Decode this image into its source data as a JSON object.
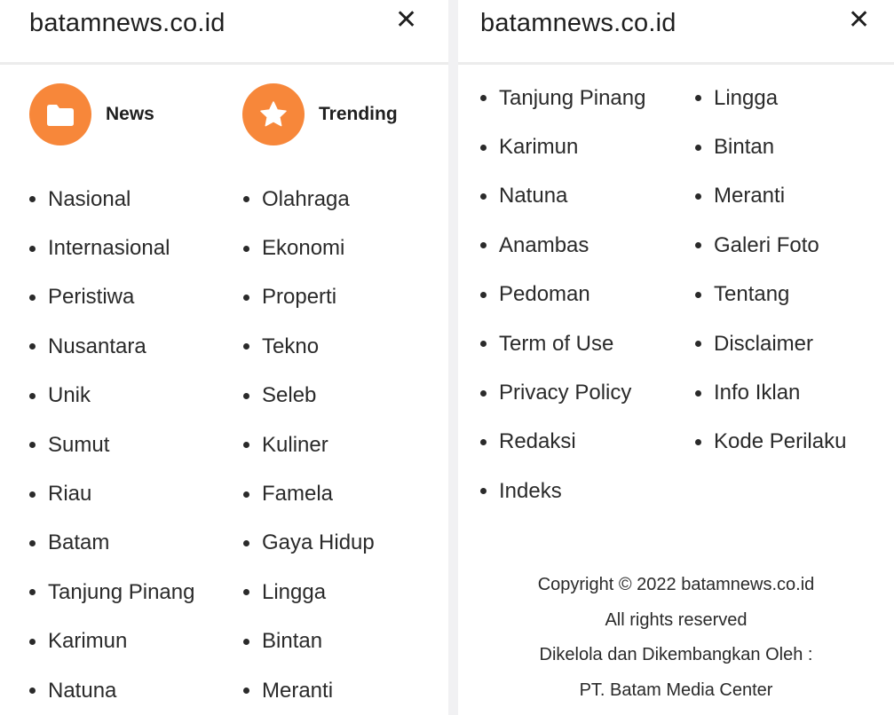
{
  "left": {
    "site_name": "batamnews.co.id",
    "close_label": "✕",
    "categories": [
      {
        "label": "News",
        "icon": "folder-icon"
      },
      {
        "label": "Trending",
        "icon": "star-icon"
      }
    ],
    "news_links": [
      "Nasional",
      "Internasional",
      "Peristiwa",
      "Nusantara",
      "Unik",
      "Sumut",
      "Riau",
      "Batam",
      "Tanjung Pinang",
      "Karimun",
      "Natuna"
    ],
    "trending_links": [
      "Olahraga",
      "Ekonomi",
      "Properti",
      "Tekno",
      "Seleb",
      "Kuliner",
      "Famela",
      "Gaya Hidup",
      "Lingga",
      "Bintan",
      "Meranti"
    ]
  },
  "right": {
    "site_name": "batamnews.co.id",
    "close_label": "✕",
    "col1_links": [
      "Tanjung Pinang",
      "Karimun",
      "Natuna",
      "Anambas",
      "Pedoman",
      "Term of Use",
      "Privacy Policy",
      "Redaksi",
      "Indeks"
    ],
    "col2_links": [
      "Lingga",
      "Bintan",
      "Meranti",
      "Galeri Foto",
      "Tentang",
      "Disclaimer",
      "Info Iklan",
      "Kode Perilaku"
    ],
    "footer": {
      "copyright": "Copyright © 2022 batamnews.co.id",
      "rights": "All rights reserved",
      "managed_by": "Dikelola dan Dikembangkan Oleh :",
      "company": "PT. Batam Media Center"
    }
  },
  "colors": {
    "accent": "#f7873a",
    "text": "#2a2a2a",
    "divider": "#ececec"
  }
}
